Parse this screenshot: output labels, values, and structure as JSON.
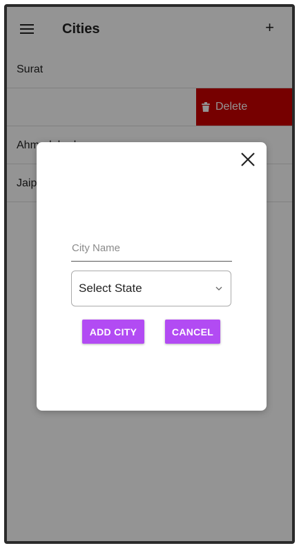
{
  "appbar": {
    "title": "Cities",
    "menu_icon": "hamburger-menu-icon",
    "add_icon": "plus-icon",
    "add_label": "+"
  },
  "list": {
    "rows": [
      {
        "label": "Surat"
      },
      {
        "label": ""
      },
      {
        "label": "Ahmedabad"
      },
      {
        "label": "Jaipur"
      }
    ],
    "delete_action": {
      "label": "Delete",
      "icon": "trash-icon",
      "color": "#cc0000"
    }
  },
  "dialog": {
    "close_icon": "close-icon",
    "city_input": {
      "placeholder": "City Name",
      "value": ""
    },
    "state_select": {
      "selected": "Select State",
      "icon": "chevron-down-icon"
    },
    "add_button": "ADD CITY",
    "cancel_button": "CANCEL",
    "button_color": "#b24bf3"
  }
}
